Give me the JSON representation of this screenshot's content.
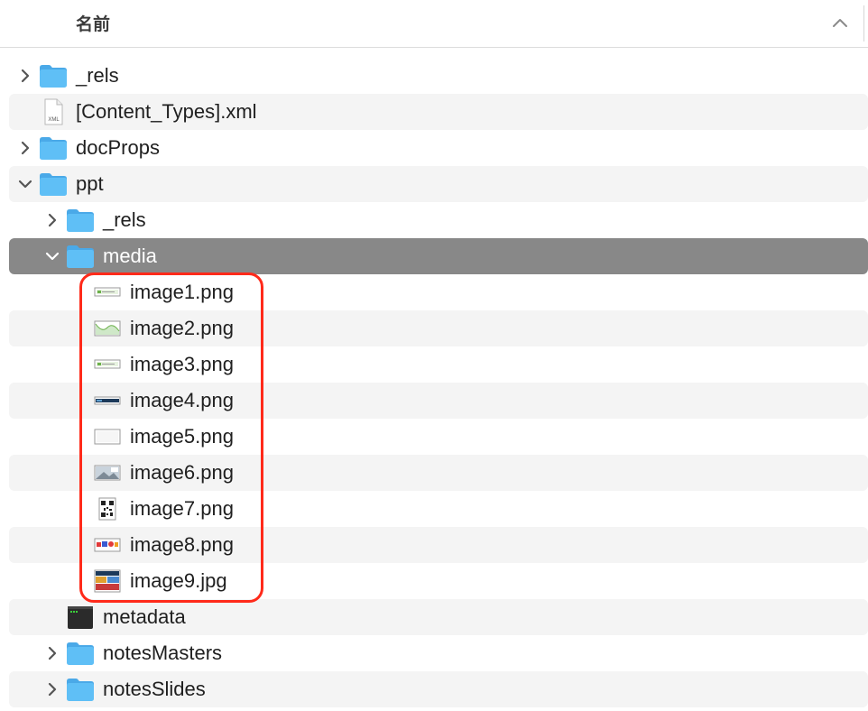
{
  "header": {
    "column_name": "名前"
  },
  "items": [
    {
      "label": "_rels",
      "kind": "folder",
      "depth": 0,
      "disclosure": "collapsed"
    },
    {
      "label": "[Content_Types].xml",
      "kind": "xml",
      "depth": 0,
      "disclosure": "none",
      "badge": "XML"
    },
    {
      "label": "docProps",
      "kind": "folder",
      "depth": 0,
      "disclosure": "collapsed"
    },
    {
      "label": "ppt",
      "kind": "folder",
      "depth": 0,
      "disclosure": "expanded"
    },
    {
      "label": "_rels",
      "kind": "folder",
      "depth": 1,
      "disclosure": "collapsed"
    },
    {
      "label": "media",
      "kind": "folder",
      "depth": 1,
      "disclosure": "expanded",
      "selected": true
    },
    {
      "label": "image1.png",
      "kind": "image",
      "depth": 2,
      "disclosure": "none",
      "thumb": "banner-green"
    },
    {
      "label": "image2.png",
      "kind": "image",
      "depth": 2,
      "disclosure": "none",
      "thumb": "wave-green"
    },
    {
      "label": "image3.png",
      "kind": "image",
      "depth": 2,
      "disclosure": "none",
      "thumb": "banner-green"
    },
    {
      "label": "image4.png",
      "kind": "image",
      "depth": 2,
      "disclosure": "none",
      "thumb": "bar-dark"
    },
    {
      "label": "image5.png",
      "kind": "image",
      "depth": 2,
      "disclosure": "none",
      "thumb": "blank"
    },
    {
      "label": "image6.png",
      "kind": "image",
      "depth": 2,
      "disclosure": "none",
      "thumb": "photo-gray"
    },
    {
      "label": "image7.png",
      "kind": "image",
      "depth": 2,
      "disclosure": "none",
      "thumb": "qr-code"
    },
    {
      "label": "image8.png",
      "kind": "image",
      "depth": 2,
      "disclosure": "none",
      "thumb": "logos-color"
    },
    {
      "label": "image9.jpg",
      "kind": "image",
      "depth": 2,
      "disclosure": "none",
      "thumb": "photo-color"
    },
    {
      "label": "metadata",
      "kind": "executable",
      "depth": 1,
      "disclosure": "none"
    },
    {
      "label": "notesMasters",
      "kind": "folder",
      "depth": 1,
      "disclosure": "collapsed"
    },
    {
      "label": "notesSlides",
      "kind": "folder",
      "depth": 1,
      "disclosure": "collapsed"
    }
  ],
  "colors": {
    "folder": "#5fbff6",
    "folder_tab": "#4aa9e8",
    "selection": "#888888",
    "highlight": "#ff2a1a",
    "alt_row": "#f4f4f4"
  }
}
